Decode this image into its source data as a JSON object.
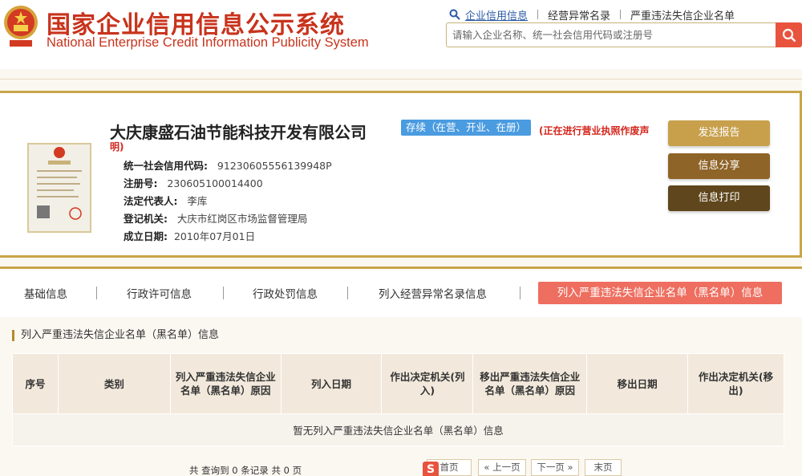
{
  "header": {
    "title_cn": "国家企业信用信息公示系统",
    "title_en": "National Enterprise Credit Information Publicity System",
    "links": [
      "企业信用信息",
      "经营异常名录",
      "严重违法失信企业名单"
    ],
    "search_placeholder": "请输入企业名称、统一社会信用代码或注册号"
  },
  "company": {
    "name": "大庆康盛石油节能科技开发有限公司",
    "status": "存续（在营、开业、在册）",
    "notice_part1": "(正在进行营业执照作废声",
    "notice_part2": "明)",
    "fields": [
      {
        "label": "统一社会信用代码:",
        "value": "91230605556139948P"
      },
      {
        "label": "注册号:",
        "value": "230605100014400"
      },
      {
        "label": "法定代表人:",
        "value": "李库"
      },
      {
        "label": "登记机关:",
        "value": "大庆市红岗区市场监督管理局"
      },
      {
        "label": "成立日期:",
        "value": "2010年07月01日"
      }
    ],
    "actions": [
      "发送报告",
      "信息分享",
      "信息打印"
    ]
  },
  "tabs": [
    "基础信息",
    "行政许可信息",
    "行政处罚信息",
    "列入经营异常名录信息",
    "列入严重违法失信企业名单（黑名单）信息"
  ],
  "section": {
    "title": "列入严重违法失信企业名单（黑名单）信息",
    "columns": [
      "序号",
      "类别",
      "列入严重违法失信企业名单（黑名单）原因",
      "列入日期",
      "作出决定机关(列入)",
      "移出严重违法失信企业名单（黑名单）原因",
      "移出日期",
      "作出决定机关(移出)"
    ],
    "empty_text": "暂无列入严重违法失信企业名单（黑名单）信息"
  },
  "pager": {
    "info": "共 查询到 0 条记录 共 0 页",
    "first": "首页",
    "prev": "« 上一页",
    "next": "下一页 »",
    "last": "末页"
  },
  "colors": {
    "brand_red": "#c8331c",
    "gold": "#c8a548",
    "active_tab": "#ee6e5f",
    "status_blue": "#4a9be0"
  }
}
